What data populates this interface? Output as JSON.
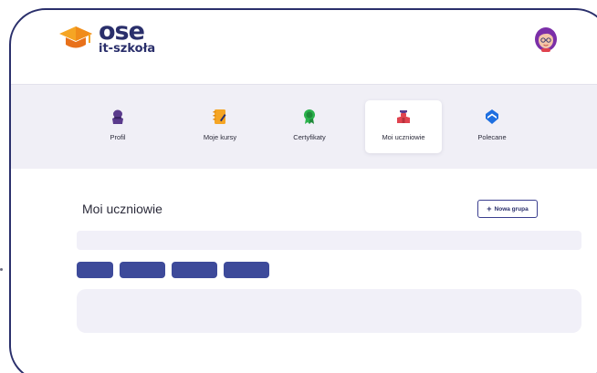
{
  "brand": {
    "name": "ose",
    "subtitle": "it-szkoła"
  },
  "colors": {
    "navy": "#2a2f6b",
    "chip": "#3d4a9a",
    "nav_bg": "#f0eff6",
    "panel_bg": "#f1f0f8",
    "purple": "#5a3a8c",
    "orange": "#f5a524",
    "green": "#2bb24c",
    "red": "#e0434f",
    "blue": "#1e6fe0"
  },
  "nav": {
    "items": [
      {
        "label": "Profil",
        "icon": "user-icon",
        "active": false
      },
      {
        "label": "Moje kursy",
        "icon": "notebook-icon",
        "active": false
      },
      {
        "label": "Certyfikaty",
        "icon": "award-icon",
        "active": false
      },
      {
        "label": "Moi uczniowie",
        "icon": "students-icon",
        "active": true
      },
      {
        "label": "Polecane",
        "icon": "recommend-icon",
        "active": false
      }
    ]
  },
  "main": {
    "title": "Moi uczniowie",
    "new_group_label": "Nowa grupa",
    "new_group_icon": "plus-icon"
  },
  "user": {
    "avatar": "avatar-icon"
  }
}
